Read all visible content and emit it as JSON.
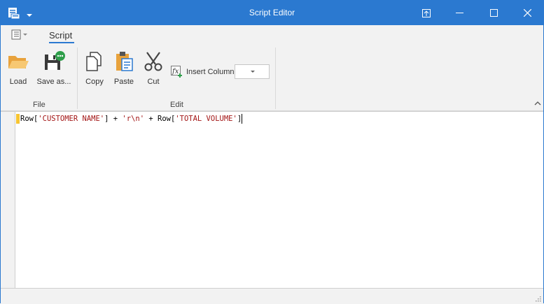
{
  "window": {
    "title": "Script Editor"
  },
  "ribbon": {
    "tabs": [
      {
        "label": "Script",
        "active": true
      }
    ],
    "groups": [
      {
        "label": "File",
        "buttons": [
          {
            "label": "Load",
            "icon": "folder-open-icon"
          },
          {
            "label": "Save as...",
            "icon": "save-as-icon"
          }
        ]
      },
      {
        "label": "Edit",
        "buttons": [
          {
            "label": "Copy",
            "icon": "copy-icon"
          },
          {
            "label": "Paste",
            "icon": "paste-icon"
          },
          {
            "label": "Cut",
            "icon": "scissors-icon"
          }
        ]
      }
    ],
    "insert_column": {
      "label": "Insert Column",
      "icon": "function-icon",
      "selected_value": ""
    }
  },
  "editor": {
    "code_parts": {
      "p1": "Row[",
      "s1": "'CUSTOMER NAME'",
      "p2": "] + ",
      "s2": "'r\\n'",
      "p3": " + Row[",
      "s3": "'TOTAL VOLUME'",
      "p4": "]"
    }
  },
  "colors": {
    "titlebar": "#2b79d0",
    "accent": "#2b79d0",
    "string": "#a31515",
    "line_marker": "#f7c531"
  }
}
